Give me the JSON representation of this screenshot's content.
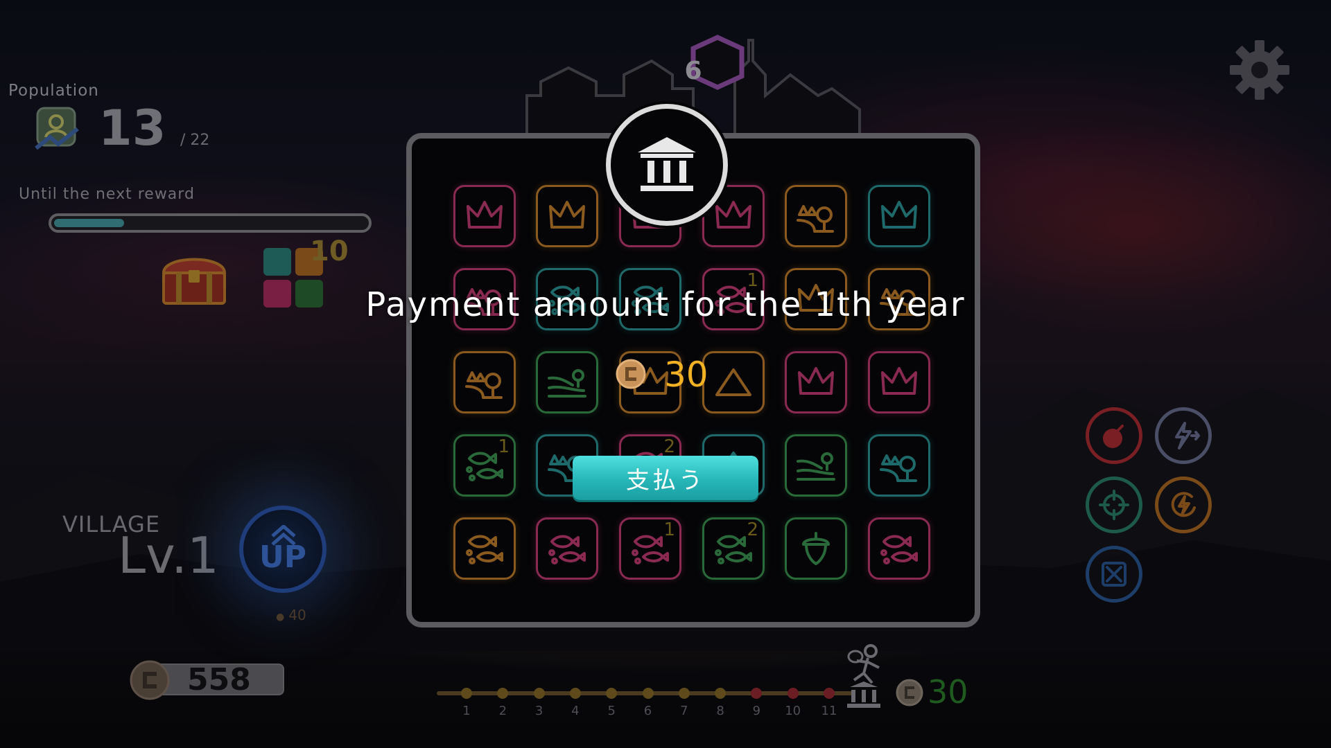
{
  "hud": {
    "population_label": "Population",
    "population_value": "13",
    "population_max": "/ 22",
    "reward_label": "Until the next reward",
    "reward_progress": 0.22,
    "chest_count": "10",
    "village_label": "VILLAGE",
    "village_level": "Lv.1",
    "up_label": "UP",
    "up_cost": "40",
    "coins": "558"
  },
  "town": {
    "hex_count": "6"
  },
  "modal": {
    "title": "Payment amount for the 1th year",
    "amount": "30",
    "pay_button": "支払う"
  },
  "board": {
    "tiles": [
      {
        "icon": "crown-icon",
        "color": "#8a2a52",
        "badge": ""
      },
      {
        "icon": "crown-icon",
        "color": "#8a5a1e",
        "badge": ""
      },
      {
        "icon": "crown-icon",
        "color": "#8a2a52",
        "badge": ""
      },
      {
        "icon": "crown-icon",
        "color": "#8a2a52",
        "badge": ""
      },
      {
        "icon": "park-icon",
        "color": "#8a5a1e",
        "badge": ""
      },
      {
        "icon": "crown-icon",
        "color": "#1e6a6a",
        "badge": ""
      },
      {
        "icon": "park-icon",
        "color": "#8a2a52",
        "badge": ""
      },
      {
        "icon": "fish-icon",
        "color": "#1e6a6a",
        "badge": ""
      },
      {
        "icon": "fish-icon",
        "color": "#1e6a6a",
        "badge": ""
      },
      {
        "icon": "fish-icon",
        "color": "#8a2a52",
        "badge": "1"
      },
      {
        "icon": "crown-icon",
        "color": "#8a5a1e",
        "badge": ""
      },
      {
        "icon": "park-icon",
        "color": "#8a5a1e",
        "badge": ""
      },
      {
        "icon": "park-icon",
        "color": "#8a5a1e",
        "badge": ""
      },
      {
        "icon": "field-icon",
        "color": "#2a6a3a",
        "badge": ""
      },
      {
        "icon": "crown-icon",
        "color": "#8a5a1e",
        "badge": ""
      },
      {
        "icon": "mountain-icon",
        "color": "#8a5a1e",
        "badge": ""
      },
      {
        "icon": "crown-icon",
        "color": "#8a2a52",
        "badge": ""
      },
      {
        "icon": "crown-icon",
        "color": "#8a2a52",
        "badge": ""
      },
      {
        "icon": "fish-icon",
        "color": "#2a6a3a",
        "badge": "1"
      },
      {
        "icon": "park-icon",
        "color": "#1e6a6a",
        "badge": ""
      },
      {
        "icon": "fish-icon",
        "color": "#8a2a52",
        "badge": "2"
      },
      {
        "icon": "mountain-icon",
        "color": "#1e6a6a",
        "badge": ""
      },
      {
        "icon": "field-icon",
        "color": "#2a6a3a",
        "badge": ""
      },
      {
        "icon": "park-icon",
        "color": "#1e6a6a",
        "badge": ""
      },
      {
        "icon": "fish-icon",
        "color": "#8a5a1e",
        "badge": ""
      },
      {
        "icon": "fish-icon",
        "color": "#8a2a52",
        "badge": ""
      },
      {
        "icon": "fish-icon",
        "color": "#8a2a52",
        "badge": "1"
      },
      {
        "icon": "fish-icon",
        "color": "#2a6a3a",
        "badge": "2"
      },
      {
        "icon": "acorn-icon",
        "color": "#2a6a3a",
        "badge": ""
      },
      {
        "icon": "fish-icon",
        "color": "#8a2a52",
        "badge": ""
      }
    ]
  },
  "abilities": [
    {
      "name": "bomb-ability-button",
      "icon": "bomb-icon",
      "color": "#7a1f24"
    },
    {
      "name": "lightning-redirect-button",
      "icon": "lightning-arrow-icon",
      "color": "#4a4e66"
    },
    {
      "name": "target-ability-button",
      "icon": "crosshair-icon",
      "color": "#1e5a4a"
    },
    {
      "name": "lightning-refresh-button",
      "icon": "lightning-cycle-icon",
      "color": "#7a4a18"
    },
    {
      "name": "shuffle-ability-button",
      "icon": "shuffle-icon",
      "color": "#1e3e6a"
    }
  ],
  "timeline": {
    "labels": [
      "1",
      "2",
      "3",
      "4",
      "5",
      "6",
      "7",
      "8",
      "9",
      "10",
      "11"
    ],
    "amount": "30"
  }
}
